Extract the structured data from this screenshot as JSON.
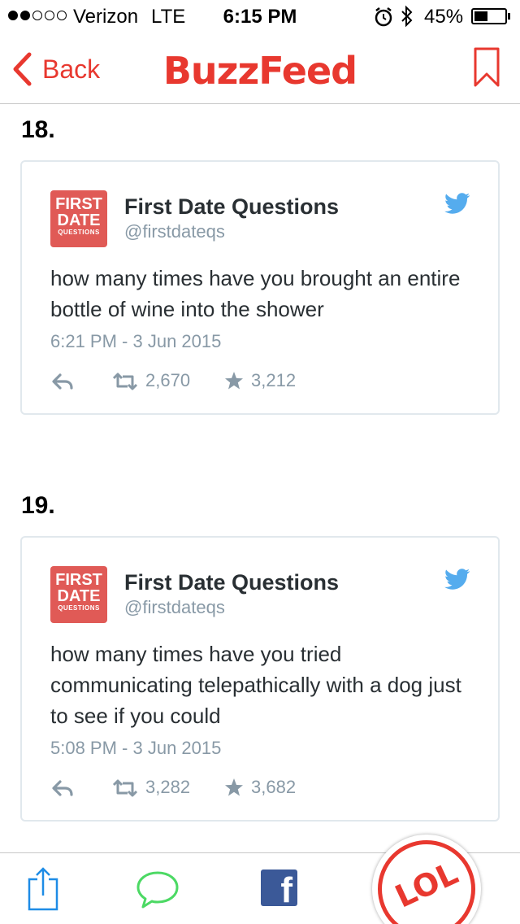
{
  "status_bar": {
    "carrier": "Verizon",
    "network": "LTE",
    "time": "6:15 PM",
    "battery_percent_text": "45%",
    "battery_level": 0.45,
    "signal_bars_filled": 2,
    "signal_bars_total": 5
  },
  "nav": {
    "back_label": "Back",
    "logo_text": "BuzzFeed",
    "accent_color": "#e8382f"
  },
  "items": [
    {
      "number": "18.",
      "tweet": {
        "avatar_line1": "FIRST",
        "avatar_line2": "DATE",
        "avatar_line3": "QUESTIONS",
        "name": "First Date Questions",
        "handle": "@firstdateqs",
        "text": "how many times have you brought an entire bottle of wine into the shower",
        "date": "6:21 PM - 3 Jun 2015",
        "retweets": "2,670",
        "favorites": "3,212"
      }
    },
    {
      "number": "19.",
      "tweet": {
        "avatar_line1": "FIRST",
        "avatar_line2": "DATE",
        "avatar_line3": "QUESTIONS",
        "name": "First Date Questions",
        "handle": "@firstdateqs",
        "text": "how many times have you tried communicating telepathically with a dog just to see if you could",
        "date": "5:08 PM - 3 Jun 2015",
        "retweets": "3,282",
        "favorites": "3,682"
      }
    }
  ],
  "toolbar": {
    "facebook_glyph": "f",
    "lol_label": "LOL"
  },
  "icons": [
    "back-chevron-icon",
    "bookmark-icon",
    "twitter-bird-icon",
    "reply-icon",
    "retweet-icon",
    "star-icon",
    "share-icon",
    "comment-icon",
    "facebook-icon",
    "alarm-icon",
    "bluetooth-icon"
  ]
}
